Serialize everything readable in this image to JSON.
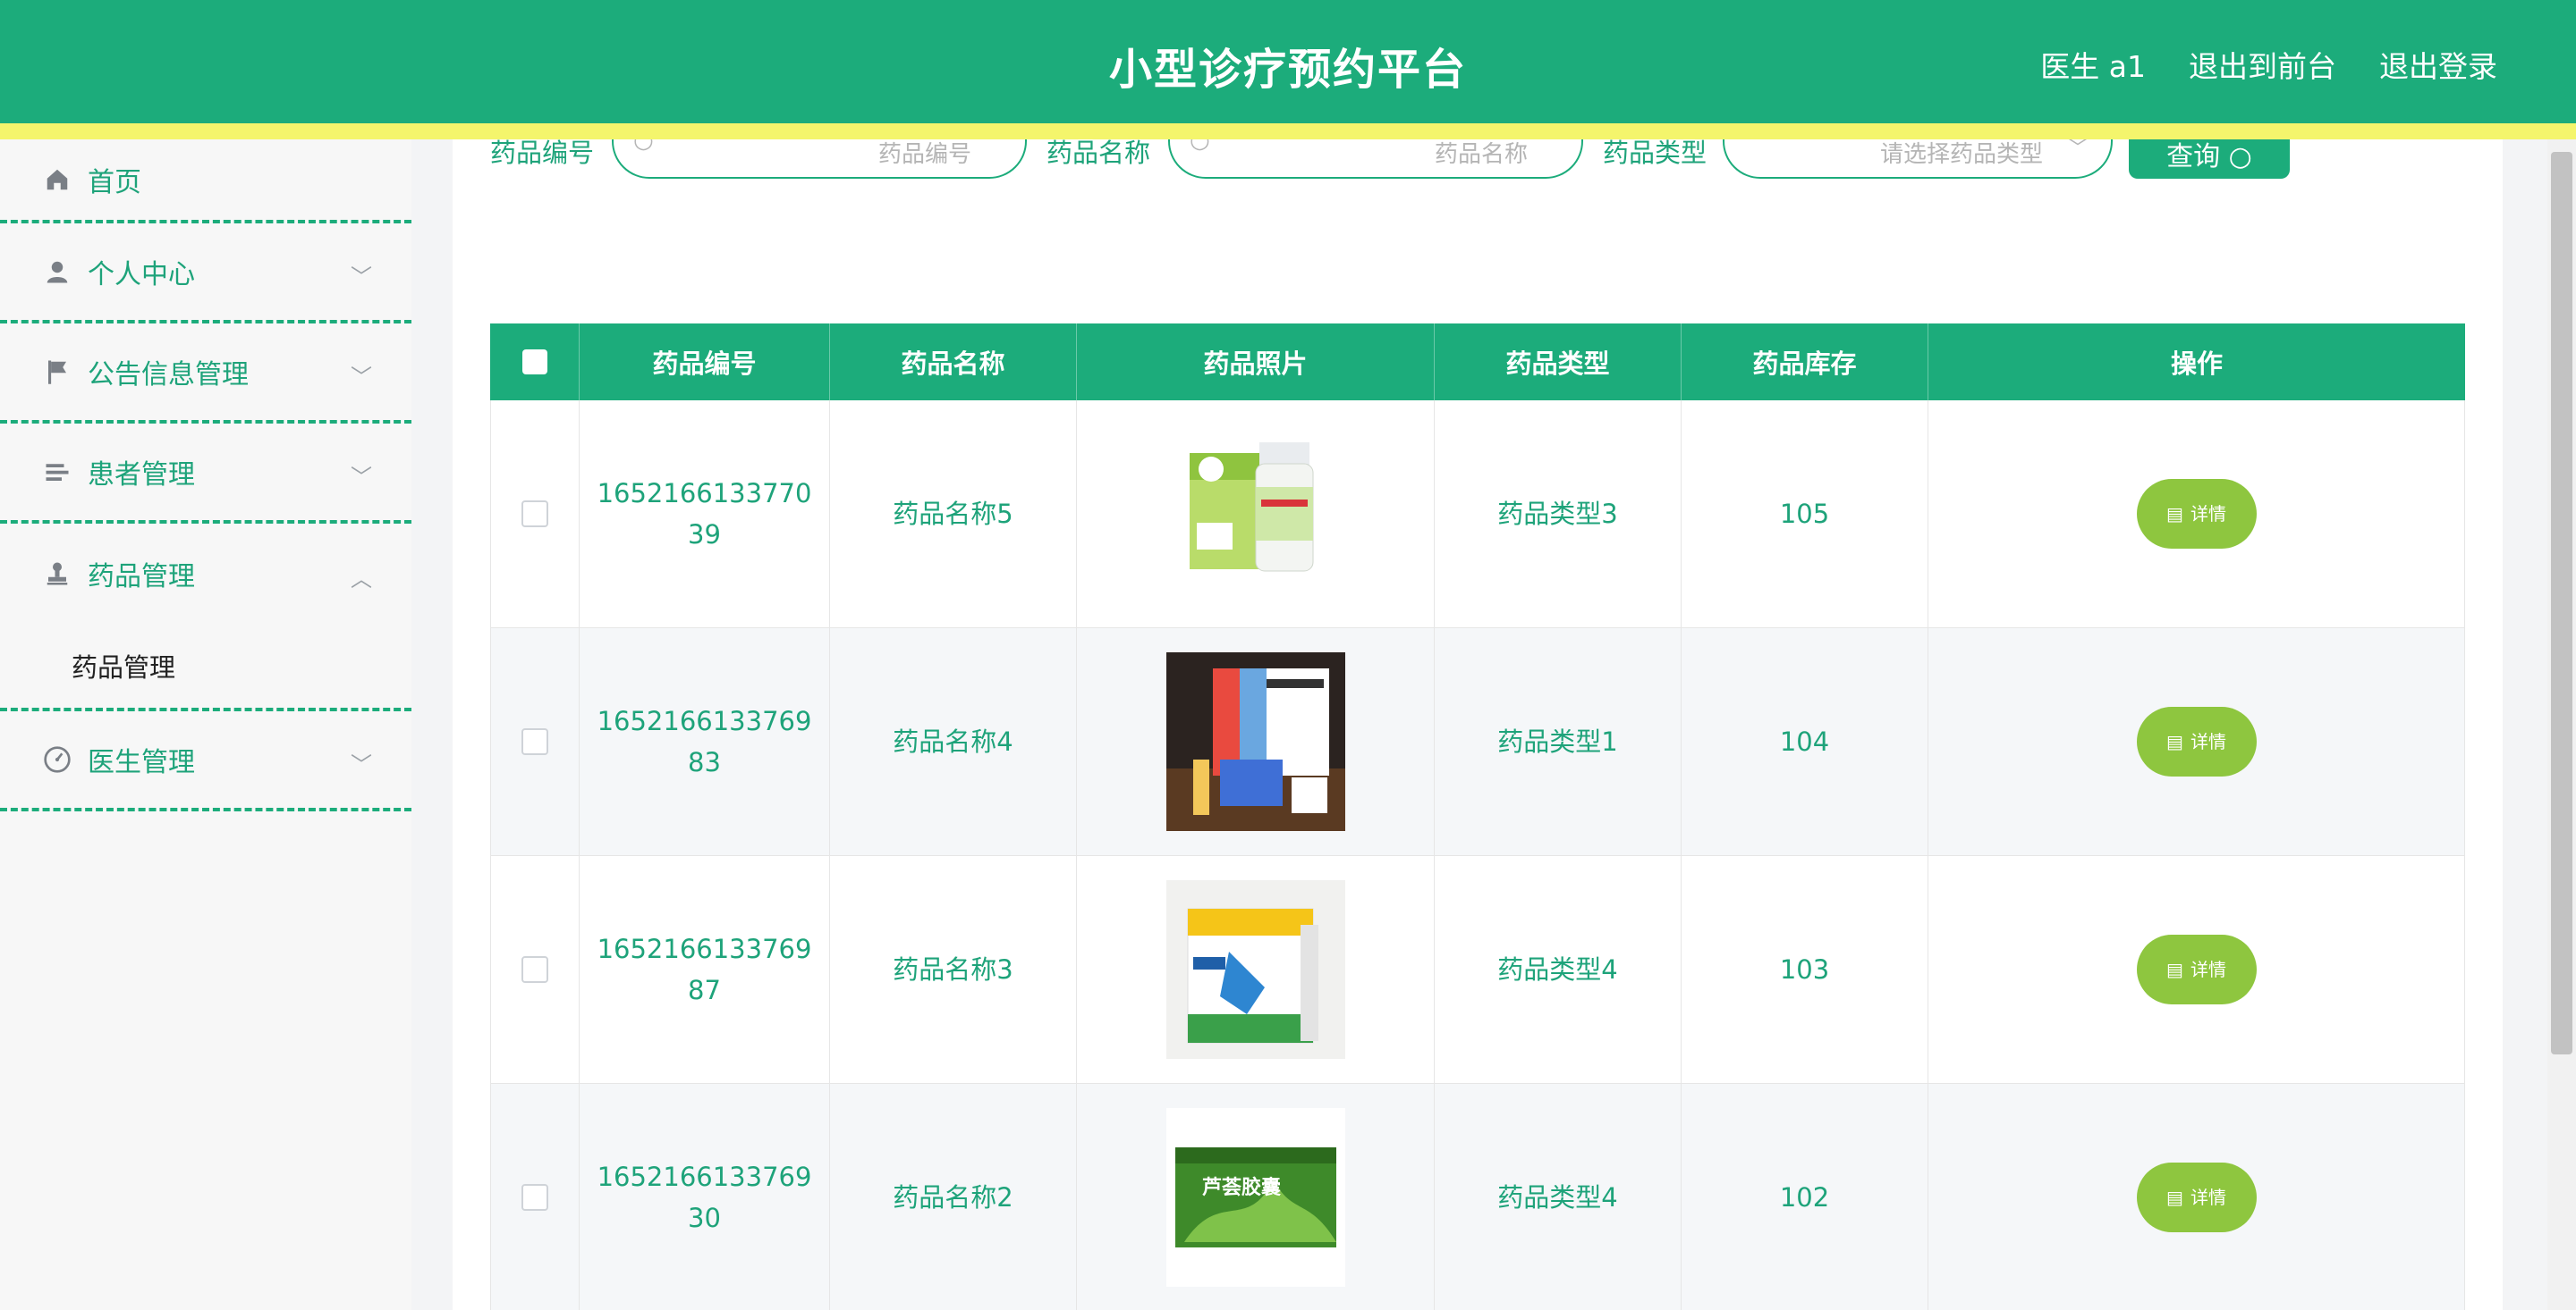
{
  "header": {
    "title": "小型诊疗预约平台",
    "nav": [
      "医生 a1",
      "退出到前台",
      "退出登录"
    ]
  },
  "sidebar": {
    "items": [
      {
        "label": "首页",
        "icon": "home-icon"
      },
      {
        "label": "个人中心",
        "icon": "user-icon",
        "expanded": false
      },
      {
        "label": "公告信息管理",
        "icon": "flag-icon",
        "expanded": false
      },
      {
        "label": "患者管理",
        "icon": "list-icon",
        "expanded": false
      },
      {
        "label": "药品管理",
        "icon": "stamp-icon",
        "expanded": true,
        "children": [
          "药品管理"
        ]
      },
      {
        "label": "医生管理",
        "icon": "gauge-icon",
        "expanded": false
      }
    ]
  },
  "search": {
    "fields": [
      {
        "label": "药品编号",
        "placeholder": "药品编号"
      },
      {
        "label": "药品名称",
        "placeholder": "药品名称"
      },
      {
        "label": "药品类型",
        "placeholder": "请选择药品类型"
      }
    ],
    "button": "查询"
  },
  "table": {
    "columns": [
      "药品编号",
      "药品名称",
      "药品照片",
      "药品类型",
      "药品库存",
      "操作"
    ],
    "rows": [
      {
        "code": "165216613377039",
        "name": "药品名称5",
        "type": "药品类型3",
        "stock": "105",
        "action": "详情",
        "photo": "pill-bottle"
      },
      {
        "code": "165216613376983",
        "name": "药品名称4",
        "type": "药品类型1",
        "stock": "104",
        "action": "详情",
        "photo": "vial-box"
      },
      {
        "code": "165216613376987",
        "name": "药品名称3",
        "type": "药品类型4",
        "stock": "103",
        "action": "详情",
        "photo": "tablet-box"
      },
      {
        "code": "165216613376930",
        "name": "药品名称2",
        "type": "药品类型4",
        "stock": "102",
        "action": "详情",
        "photo": "aloe-box"
      }
    ]
  },
  "image_text": {
    "row4": "芦荟胶囊"
  },
  "colors": {
    "primary": "#1cac7b",
    "accent_bar": "#f4f56c",
    "detail_button": "#8ec63f",
    "text": "#1ea37a"
  }
}
